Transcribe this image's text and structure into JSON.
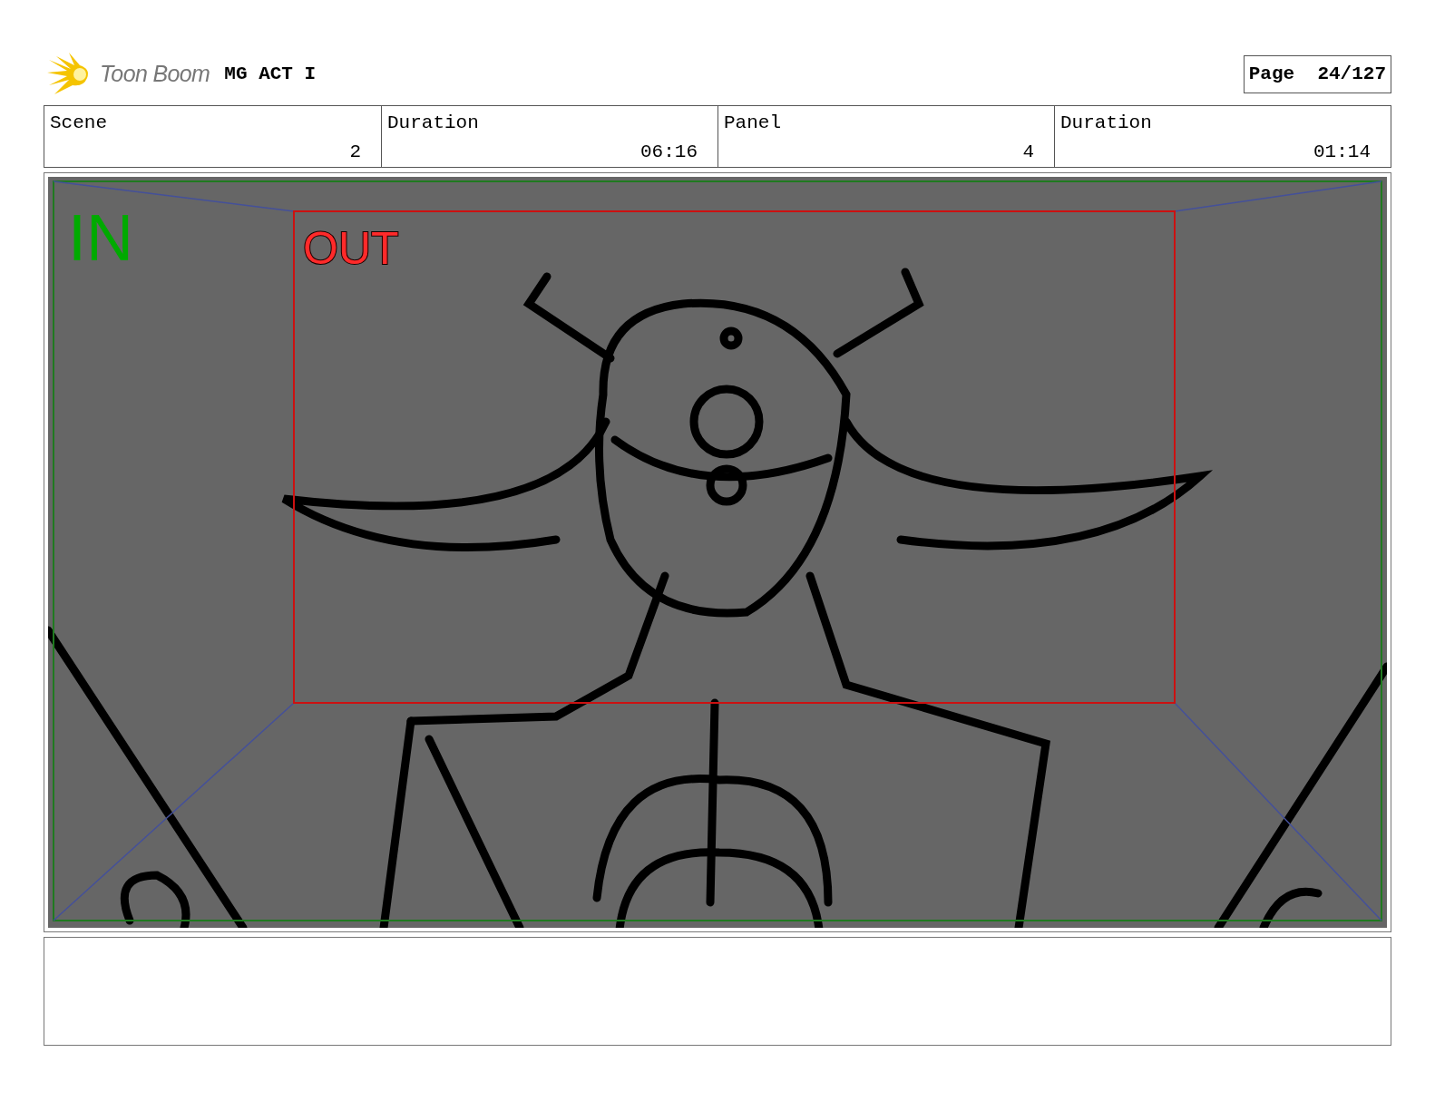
{
  "header": {
    "brand": "Toon Boom",
    "project": "MG ACT I",
    "page": "Page  24/127"
  },
  "info": [
    {
      "label": "Scene",
      "value": "2"
    },
    {
      "label": "Duration",
      "value": "06:16"
    },
    {
      "label": "Panel",
      "value": "4"
    },
    {
      "label": "Duration",
      "value": "01:14"
    }
  ],
  "panel": {
    "in_label": "IN",
    "out_label": "OUT"
  }
}
